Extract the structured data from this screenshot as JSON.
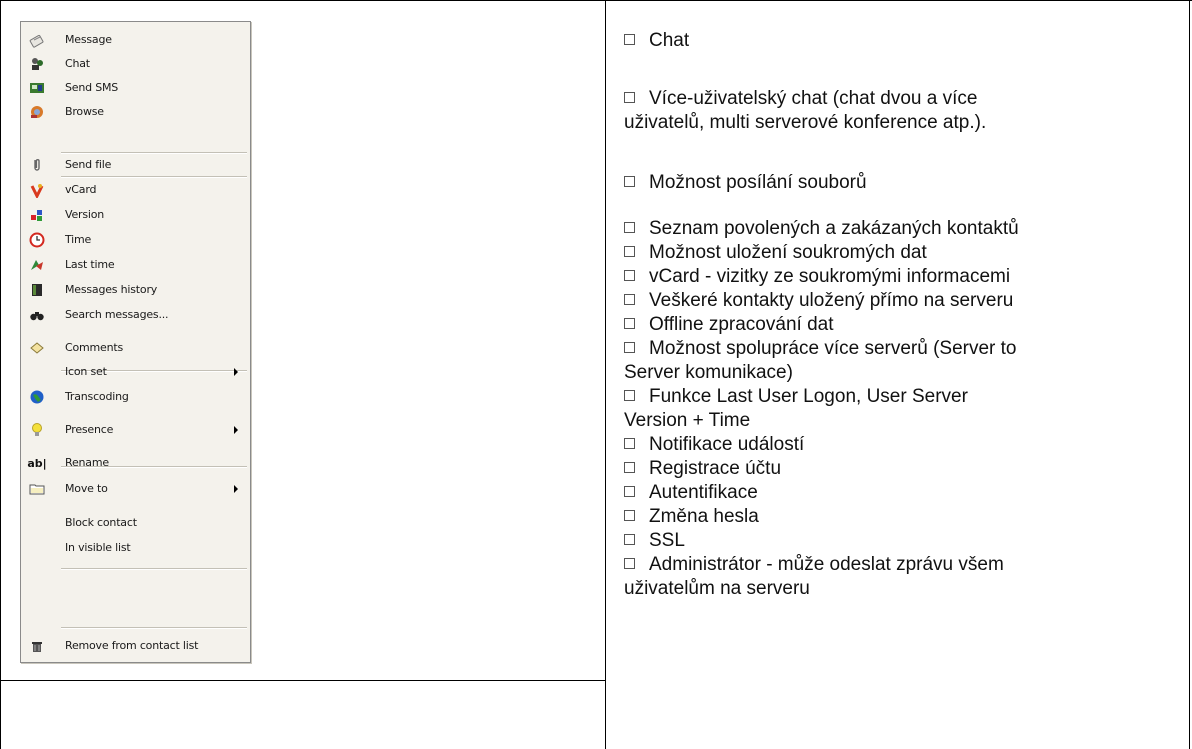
{
  "menu": {
    "items": [
      {
        "label": "Message",
        "icon": "pencil-note-icon",
        "submenu": false
      },
      {
        "label": "Chat",
        "icon": "chat-people-icon",
        "submenu": false
      },
      {
        "label": "Send SMS",
        "icon": "sms-phone-icon",
        "submenu": false
      },
      {
        "label": "Browse",
        "icon": "browse-globe-icon",
        "submenu": false
      },
      {
        "label": "Send file",
        "icon": "paperclip-icon",
        "submenu": false
      },
      {
        "label": "vCard",
        "icon": "vcard-icon",
        "submenu": false
      },
      {
        "label": "Version",
        "icon": "version-blocks-icon",
        "submenu": false
      },
      {
        "label": "Time",
        "icon": "clock-icon",
        "submenu": false
      },
      {
        "label": "Last time",
        "icon": "last-time-icon",
        "submenu": false
      },
      {
        "label": "Messages history",
        "icon": "history-book-icon",
        "submenu": false
      },
      {
        "label": "Search messages...",
        "icon": "binoculars-icon",
        "submenu": false
      },
      {
        "label": "Comments",
        "icon": "comment-diamond-icon",
        "submenu": false
      },
      {
        "label": "Icon set",
        "icon": "",
        "submenu": true
      },
      {
        "label": "Transcoding",
        "icon": "globe-icon",
        "submenu": false
      },
      {
        "label": "Presence",
        "icon": "lightbulb-icon",
        "submenu": true
      },
      {
        "label": "Rename",
        "icon": "rename-ab-icon",
        "submenu": false
      },
      {
        "label": "Move to",
        "icon": "folder-icon",
        "submenu": true
      },
      {
        "label": "Block contact",
        "icon": "",
        "submenu": false
      },
      {
        "label": "In visible list",
        "icon": "",
        "submenu": false
      },
      {
        "label": "Remove from contact list",
        "icon": "trash-bin-icon",
        "submenu": false
      }
    ],
    "rename_icon_text": "ab|"
  },
  "features": [
    {
      "text": "Chat"
    },
    {
      "text": "Více-uživatelský chat (chat dvou a více",
      "cont": "uživatelů, multi serverové konference atp.)."
    },
    {
      "text": "Možnost posílání souborů"
    },
    {
      "text": "Seznam povolených a zakázaných kontaktů"
    },
    {
      "text": "Možnost uložení soukromých dat"
    },
    {
      "text": "vCard - vizitky ze soukromými informacemi"
    },
    {
      "text": "Veškeré kontakty uložený přímo na serveru"
    },
    {
      "text": "Offline zpracování dat"
    },
    {
      "text": "Možnost spolupráce více serverů (Server to",
      "cont": "Server komunikace)"
    },
    {
      "text": "Funkce Last User Logon, User Server",
      "cont": "Version + Time"
    },
    {
      "text": "Notifikace událostí"
    },
    {
      "text": "Registrace účtu"
    },
    {
      "text": "Autentifikace"
    },
    {
      "text": "Změna hesla"
    },
    {
      "text": "SSL"
    },
    {
      "text": "Administrátor - může odeslat zprávu všem",
      "cont": "uživatelům na serveru"
    }
  ]
}
